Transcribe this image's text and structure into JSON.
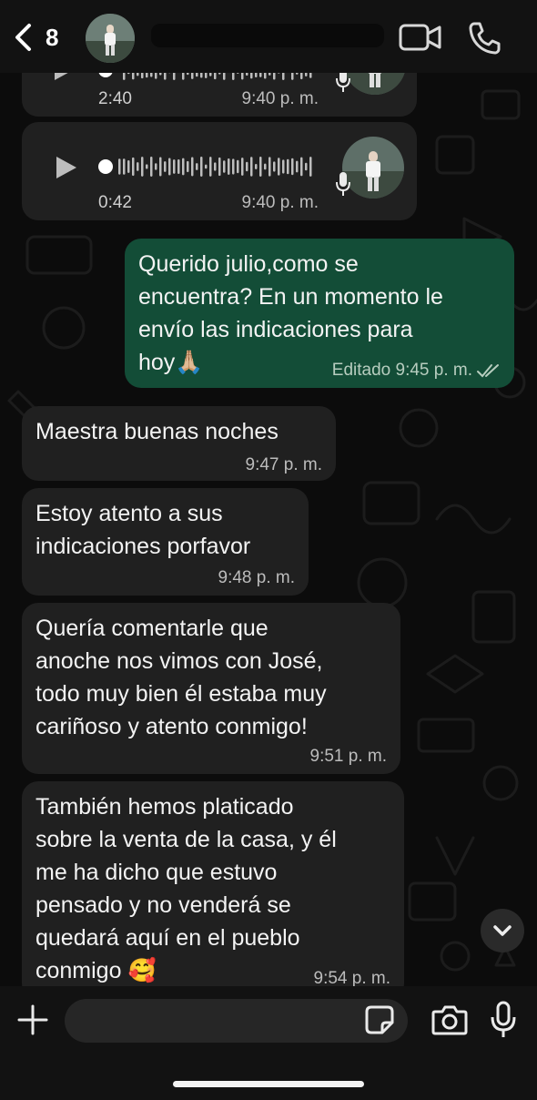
{
  "header": {
    "unread_count": "8",
    "contact_name": ""
  },
  "voice_notes": [
    {
      "duration": "2:40",
      "time": "9:40 p. m."
    },
    {
      "duration": "0:42",
      "time": "9:40 p. m."
    }
  ],
  "messages": [
    {
      "direction": "outgoing",
      "text": "Querido julio,como se\nencuentra? En un momento le\nenvío las indicaciones para\nhoy🙏🏼",
      "time": "Editado 9:45 p. m."
    },
    {
      "direction": "incoming",
      "text": "Maestra buenas noches",
      "time": "9:47 p. m."
    },
    {
      "direction": "incoming",
      "text": "Estoy atento a sus\nindicaciones porfavor",
      "time": "9:48 p. m."
    },
    {
      "direction": "incoming",
      "text": "Quería comentarle que\nanoche nos vimos con José,\ntodo muy bien él estaba muy\ncariñoso y atento conmigo!",
      "time": "9:51 p. m."
    },
    {
      "direction": "incoming",
      "text": "También hemos platicado\nsobre la venta de la casa, y él\nme ha dicho que estuvo\npensado y no venderá se\nquedará aquí en el pueblo\nconmigo 🥰",
      "time": "9:54 p. m."
    }
  ],
  "composer": {
    "placeholder": ""
  },
  "colors": {
    "outgoing_bubble": "#134d37",
    "incoming_bubble": "#202020",
    "background": "#0c0c0c"
  },
  "icons": [
    "back-chevron-icon",
    "video-call-icon",
    "phone-icon",
    "play-icon",
    "mic-icon",
    "plus-icon",
    "sticker-icon",
    "camera-icon",
    "chevron-down-icon",
    "double-check-icon"
  ]
}
